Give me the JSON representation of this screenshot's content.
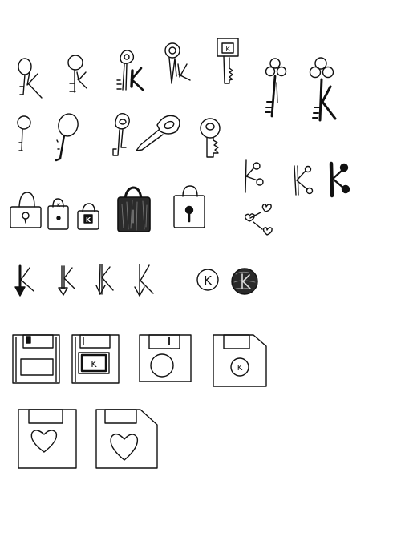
{
  "sheet": {
    "ink_color": "#111111",
    "paper_color": "#ffffff",
    "rows": [
      {
        "name": "key-sketches",
        "icons": [
          "key-k-icon",
          "key-k-icon",
          "key-k-bold-icon",
          "key-k-icon",
          "key-tag-icon",
          "key-trefoil-icon",
          "key-trefoil-icon",
          "key-icon",
          "key-icon",
          "key-icon",
          "key-icon",
          "key-icon"
        ],
        "tag_letter": "K"
      },
      {
        "name": "share-k-sketches",
        "icons": [
          "share-icon",
          "share-k-icon",
          "share-k-bold-icon",
          "share-hearts-icon"
        ]
      },
      {
        "name": "padlock-sketches",
        "icons": [
          "padlock-icon",
          "padlock-k-icon",
          "padlock-k-icon",
          "padlock-filled-icon",
          "padlock-icon"
        ],
        "small_lock_letter": "K",
        "label_letter": "K"
      },
      {
        "name": "k-arrow-sketches",
        "icons": [
          "k-arrow-icon",
          "k-arrow-icon",
          "k-arrow-icon",
          "k-arrow-icon",
          "k-circle-icon",
          "k-circle-filled-icon"
        ],
        "circle_letter": "K"
      },
      {
        "name": "floppy-k-sketches",
        "icons": [
          "floppy-disk-icon",
          "floppy-disk-k-icon",
          "floppy-disk-circle-icon",
          "floppy-disk-k-circle-icon"
        ],
        "label_letter": "K",
        "circle_letter": "K"
      },
      {
        "name": "floppy-heart-sketches",
        "icons": [
          "floppy-disk-heart-icon",
          "floppy-disk-heart-icon"
        ]
      }
    ]
  }
}
